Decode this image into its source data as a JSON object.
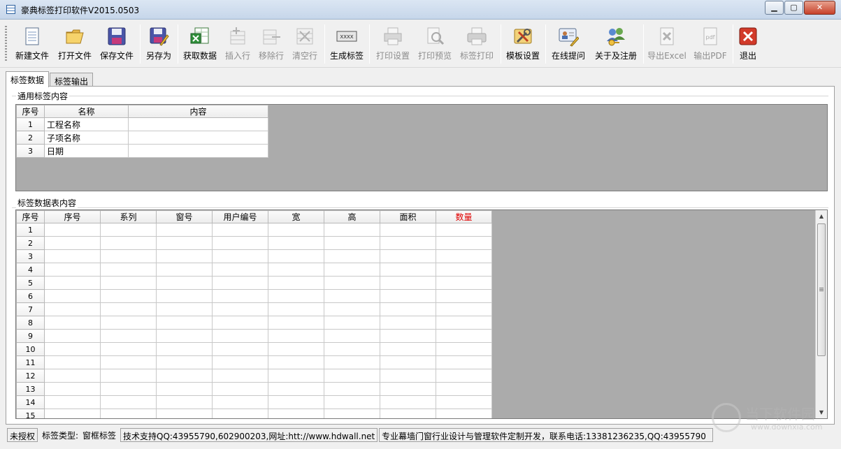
{
  "window": {
    "title": "豪典标签打印软件V2015.0503",
    "minimize": "▁",
    "maximize": "▢",
    "close": "✕"
  },
  "toolbar": [
    {
      "label": "新建文件",
      "icon": "new-file-icon",
      "enabled": true
    },
    {
      "label": "打开文件",
      "icon": "open-folder-icon",
      "enabled": true
    },
    {
      "label": "保存文件",
      "icon": "save-disk-icon",
      "enabled": true
    },
    {
      "label": "另存为",
      "icon": "save-as-icon",
      "enabled": true
    },
    {
      "label": "获取数据",
      "icon": "excel-import-icon",
      "enabled": true
    },
    {
      "label": "插入行",
      "icon": "insert-row-icon",
      "enabled": false
    },
    {
      "label": "移除行",
      "icon": "remove-row-icon",
      "enabled": false
    },
    {
      "label": "清空行",
      "icon": "clear-row-icon",
      "enabled": false
    },
    {
      "label": "生成标签",
      "icon": "generate-label-icon",
      "enabled": true,
      "icon_text": "XXXX"
    },
    {
      "label": "打印设置",
      "icon": "print-settings-icon",
      "enabled": false
    },
    {
      "label": "打印预览",
      "icon": "print-preview-icon",
      "enabled": false
    },
    {
      "label": "标签打印",
      "icon": "printer-icon",
      "enabled": false
    },
    {
      "label": "模板设置",
      "icon": "template-tools-icon",
      "enabled": true
    },
    {
      "label": "在线提问",
      "icon": "online-question-icon",
      "enabled": true
    },
    {
      "label": "关于及注册",
      "icon": "about-register-icon",
      "enabled": true
    },
    {
      "label": "导出Excel",
      "icon": "export-excel-icon",
      "enabled": false
    },
    {
      "label": "输出PDF",
      "icon": "export-pdf-icon",
      "enabled": false,
      "icon_text": "pdf"
    },
    {
      "label": "退出",
      "icon": "exit-icon",
      "enabled": true
    }
  ],
  "tabs": [
    {
      "label": "标签数据",
      "active": true
    },
    {
      "label": "标签输出",
      "active": false
    }
  ],
  "common_section": {
    "title": "通用标签内容",
    "columns": [
      "序号",
      "名称",
      "内容"
    ],
    "rows": [
      {
        "idx": "1",
        "name": "工程名称",
        "content": ""
      },
      {
        "idx": "2",
        "name": "子项名称",
        "content": ""
      },
      {
        "idx": "3",
        "name": "日期",
        "content": ""
      }
    ]
  },
  "data_section": {
    "title": "标签数据表内容",
    "columns": [
      "序号",
      "序号",
      "系列",
      "窗号",
      "用户编号",
      "宽",
      "高",
      "面积",
      "数量"
    ],
    "highlight_column": "数量",
    "highlight_color": "#e00000",
    "row_numbers": [
      "1",
      "2",
      "3",
      "4",
      "5",
      "6",
      "7",
      "8",
      "9",
      "10",
      "11",
      "12",
      "13",
      "14",
      "15"
    ]
  },
  "status": {
    "license": "未授权",
    "label_type_caption": "标签类型:",
    "label_type_value": "窗框标签",
    "support": "技术支持QQ:43955790,602900203,网址:htt://www.hdwall.net",
    "promo": "专业幕墙门窗行业设计与管理软件定制开发，联系电话:13381236235,QQ:43955790"
  },
  "watermark": {
    "text": "当下软件园",
    "url": "www.downxia.com"
  }
}
